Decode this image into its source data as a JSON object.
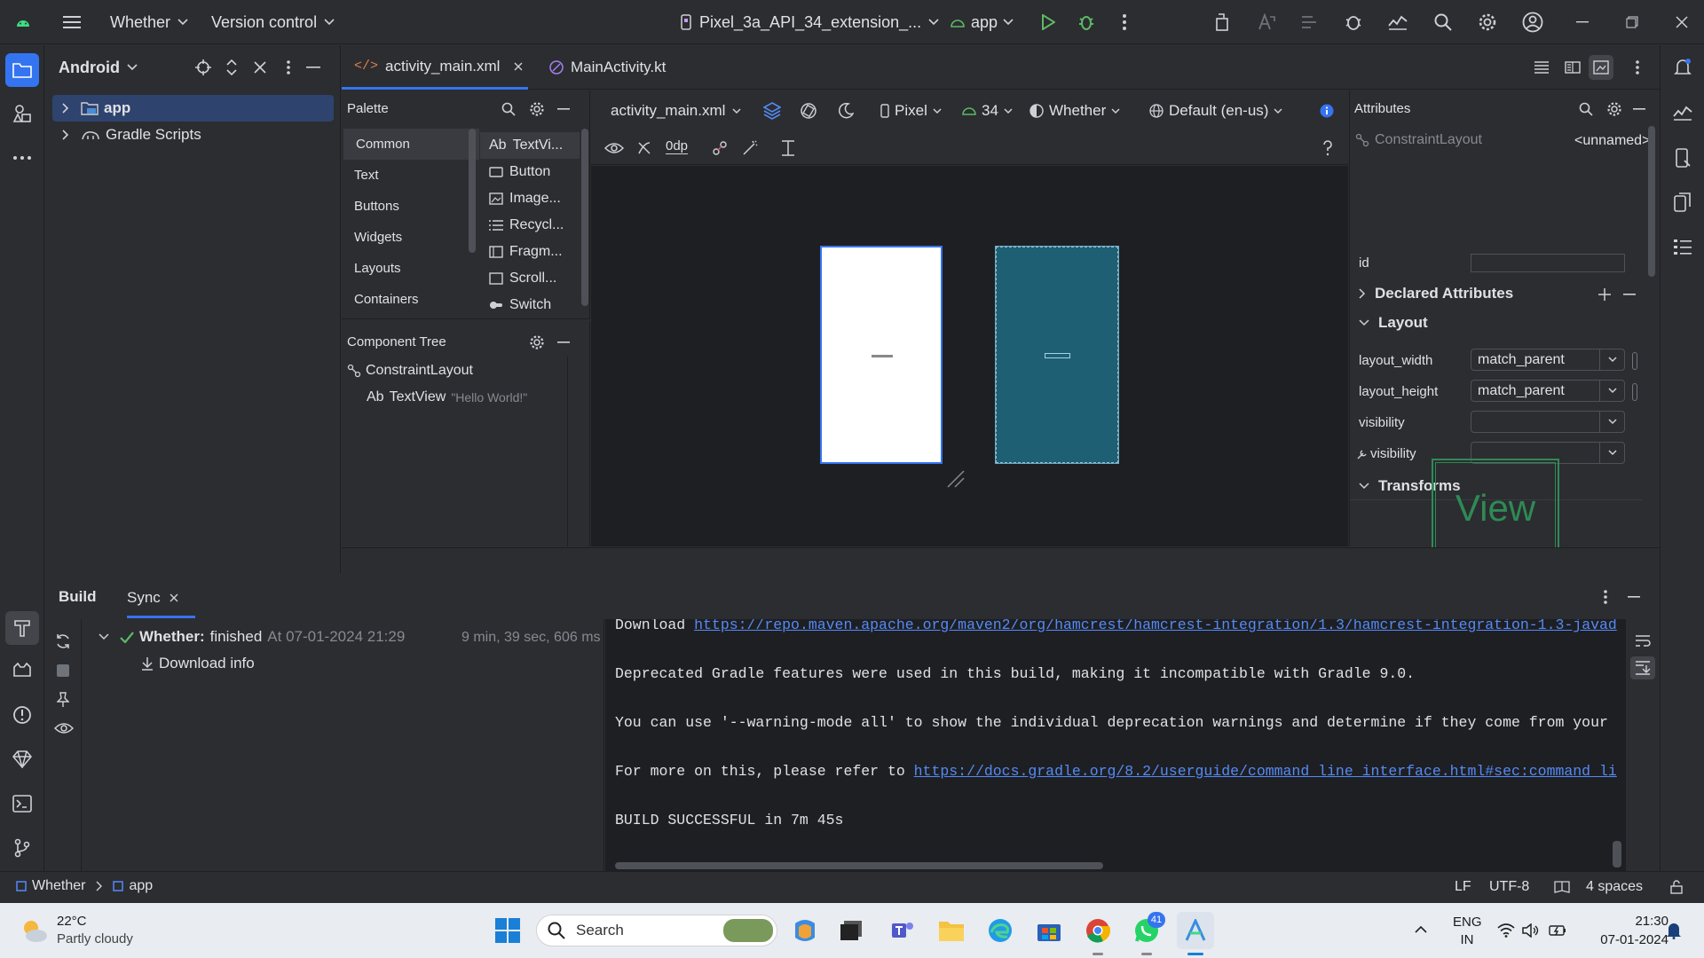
{
  "titlebar": {
    "project": "Whether",
    "vcs": "Version control",
    "device": "Pixel_3a_API_34_extension_...",
    "run_config": "app"
  },
  "project_panel": {
    "view": "Android",
    "items": [
      {
        "label": "app"
      },
      {
        "label": "Gradle Scripts"
      }
    ]
  },
  "tabs": [
    {
      "label": "activity_main.xml"
    },
    {
      "label": "MainActivity.kt"
    }
  ],
  "palette": {
    "title": "Palette",
    "categories": [
      "Common",
      "Text",
      "Buttons",
      "Widgets",
      "Layouts",
      "Containers"
    ],
    "items": [
      {
        "label": "TextVi...",
        "prefix": "Ab"
      },
      {
        "label": "Button"
      },
      {
        "label": "Image..."
      },
      {
        "label": "Recycl..."
      },
      {
        "label": "Fragm..."
      },
      {
        "label": "Scroll..."
      },
      {
        "label": "Switch"
      }
    ]
  },
  "component_tree": {
    "title": "Component Tree",
    "root": "ConstraintLayout",
    "child_prefix": "Ab",
    "child": "TextView",
    "child_text": "\"Hello World!\""
  },
  "design_toolbar": {
    "file": "activity_main.xml",
    "device": "Pixel",
    "api": "34",
    "theme": "Whether",
    "locale": "Default (en-us)",
    "margin": "0dp"
  },
  "attributes": {
    "title": "Attributes",
    "component": "ConstraintLayout",
    "name": "<unnamed>",
    "id_label": "id",
    "id_value": "",
    "sections": {
      "declared": "Declared Attributes",
      "layout": "Layout",
      "transforms": "Transforms"
    },
    "rows": [
      {
        "label": "layout_width",
        "value": "match_parent"
      },
      {
        "label": "layout_height",
        "value": "match_parent"
      },
      {
        "label": "visibility",
        "value": ""
      },
      {
        "label": "visibility",
        "value": ""
      }
    ],
    "preview_text": "View"
  },
  "build": {
    "tabs": [
      "Build",
      "Sync"
    ],
    "task_name": "Whether:",
    "task_status": "finished",
    "task_time": "At 07-01-2024 21:29",
    "task_duration": "9 min, 39 sec, 606 ms",
    "child": "Download info",
    "console": {
      "line1_prefix": "Download ",
      "line1_link": "https://repo.maven.apache.org/maven2/org/hamcrest/hamcrest-integration/1.3/hamcrest-integration-1.3-javad",
      "line2": "Deprecated Gradle features were used in this build, making it incompatible with Gradle 9.0.",
      "line3": "You can use '--warning-mode all' to show the individual deprecation warnings and determine if they come from your",
      "line4_prefix": "For more on this, please refer to ",
      "line4_link": "https://docs.gradle.org/8.2/userguide/command_line_interface.html#sec:command_li",
      "line5": "BUILD SUCCESSFUL in 7m 45s"
    }
  },
  "statusbar": {
    "crumbs": [
      "Whether",
      "app"
    ],
    "line_sep": "LF",
    "encoding": "UTF-8",
    "indent": "4 spaces"
  },
  "taskbar": {
    "temp": "22°C",
    "weather": "Partly cloudy",
    "search": "Search",
    "whatsapp_badge": "41",
    "lang1": "ENG",
    "lang2": "IN",
    "time": "21:30",
    "date": "07-01-2024"
  },
  "colors": {
    "accent": "#3574f0",
    "success": "#5fb865",
    "android_green": "#3ddc84",
    "preview_blueprint": "#1f5f73"
  }
}
